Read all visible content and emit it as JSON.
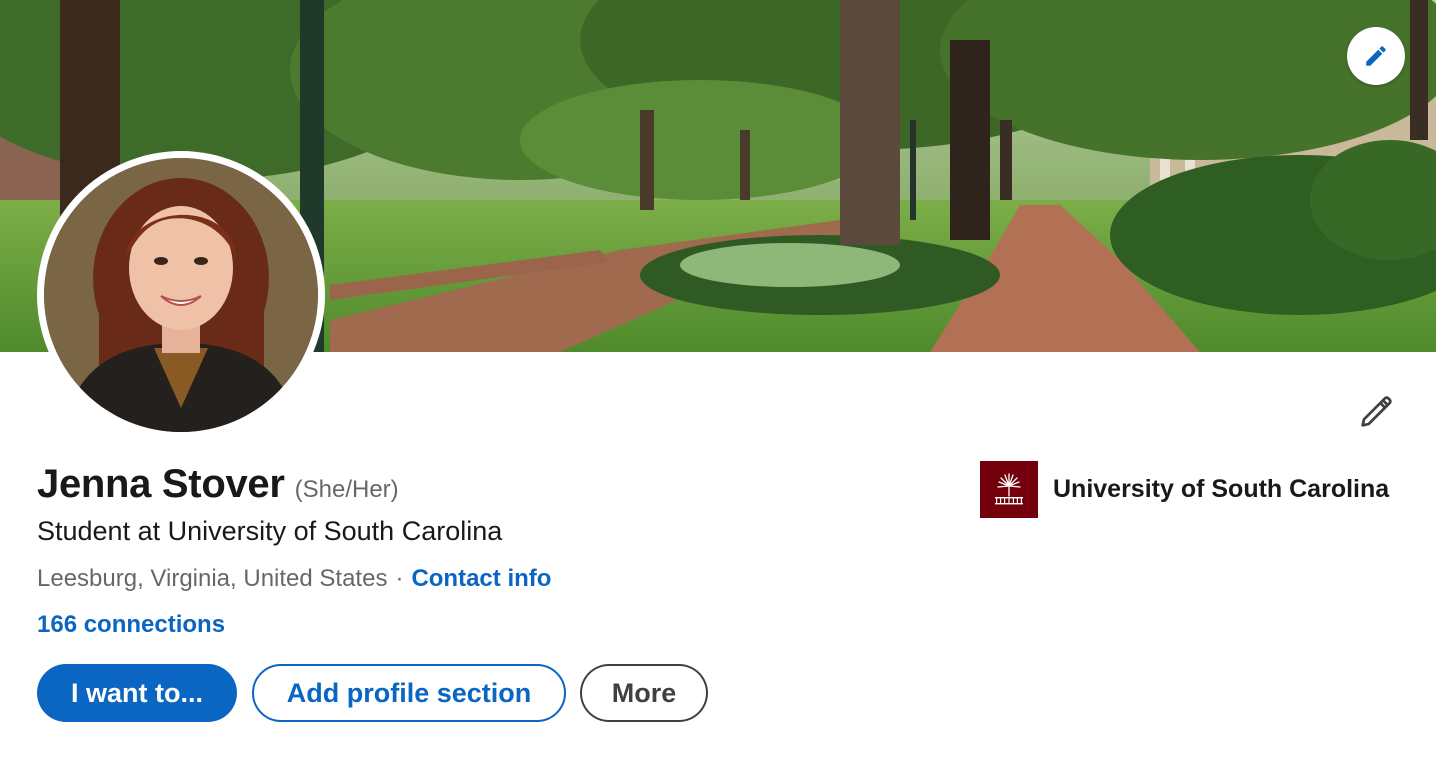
{
  "profile": {
    "name": "Jenna Stover",
    "pronouns": "(She/Her)",
    "headline": "Student at University of South Carolina",
    "location": "Leesburg, Virginia, United States",
    "separator": "·",
    "contact_info_label": "Contact info",
    "connections_label": "166 connections"
  },
  "actions": {
    "primary_label": "I want to...",
    "add_section_label": "Add profile section",
    "more_label": "More"
  },
  "education": {
    "school_name": "University of South Carolina"
  },
  "icons": {
    "cover_edit": "pencil-icon",
    "intro_edit": "pencil-icon",
    "school_logo": "palmetto-tree-icon"
  },
  "colors": {
    "accent": "#0a66c2",
    "school_brand": "#73000a"
  }
}
